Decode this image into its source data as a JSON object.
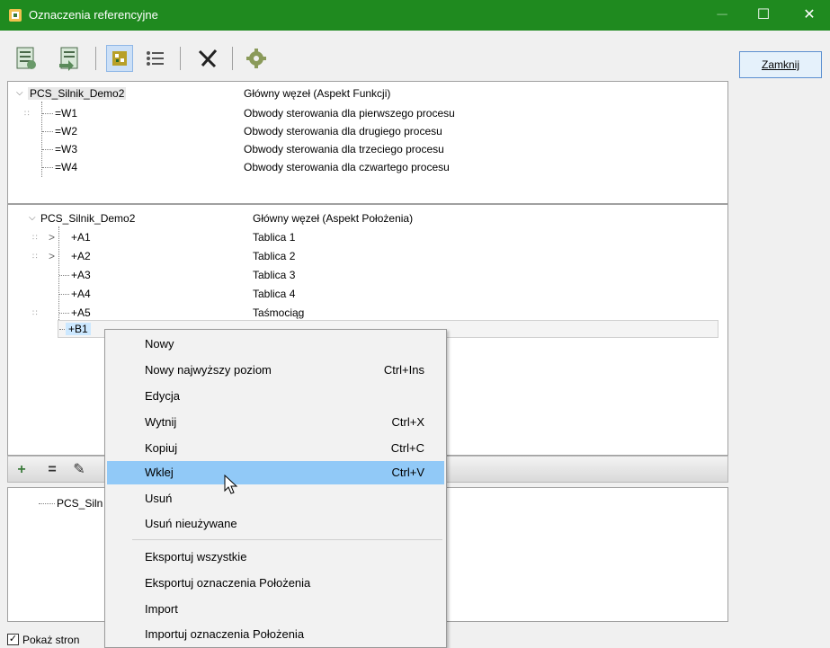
{
  "window": {
    "title": "Oznaczenia referencyjne",
    "minimize": "─",
    "maximize": "☐",
    "close": "✕"
  },
  "toolbar": {
    "icons": [
      "document-icon",
      "document-arrow-icon",
      "tree-view-icon",
      "list-view-icon",
      "cut-tool-icon",
      "gear-icon"
    ]
  },
  "close_button": {
    "label": "Zamknij"
  },
  "function_panel": {
    "rows": [
      {
        "name": "PCS_Silnik_Demo2",
        "desc": "Główny węzeł  (Aspekt Funkcji)"
      },
      {
        "name": "=W1",
        "desc": "Obwody sterowania dla pierwszego procesu"
      },
      {
        "name": "=W2",
        "desc": "Obwody sterowania dla drugiego procesu"
      },
      {
        "name": "=W3",
        "desc": "Obwody sterowania dla trzeciego procesu"
      },
      {
        "name": "=W4",
        "desc": "Obwody sterowania dla czwartego procesu"
      }
    ]
  },
  "location_panel": {
    "rows": [
      {
        "name": "PCS_Silnik_Demo2",
        "desc": "Główny węzeł  (Aspekt Położenia)"
      },
      {
        "name": "+A1",
        "desc": "Tablica 1"
      },
      {
        "name": "+A2",
        "desc": "Tablica 2"
      },
      {
        "name": "+A3",
        "desc": "Tablica 3"
      },
      {
        "name": "+A4",
        "desc": "Tablica 4"
      },
      {
        "name": "+A5",
        "desc": "Taśmociąg"
      },
      {
        "name": "+B1",
        "desc": ""
      }
    ]
  },
  "strip": {
    "add": "+",
    "remove": "=",
    "edit": "✎"
  },
  "bottom_panel": {
    "item": "PCS_Siln"
  },
  "checkbox": {
    "label": "Pokaż stron",
    "checked": true
  },
  "context_menu": {
    "items": [
      {
        "label": "Nowy",
        "shortcut": ""
      },
      {
        "label": "Nowy najwyższy poziom",
        "shortcut": "Ctrl+Ins"
      },
      {
        "label": "Edycja",
        "shortcut": ""
      },
      {
        "label": "Wytnij",
        "shortcut": "Ctrl+X"
      },
      {
        "label": "Kopiuj",
        "shortcut": "Ctrl+C"
      },
      {
        "label": "Wklej",
        "shortcut": "Ctrl+V"
      },
      {
        "label": "Usuń",
        "shortcut": ""
      },
      {
        "label": "Usuń nieużywane",
        "shortcut": ""
      },
      {
        "label": "Eksportuj wszystkie",
        "shortcut": ""
      },
      {
        "label": "Eksportuj oznaczenia Położenia",
        "shortcut": ""
      },
      {
        "label": "Import",
        "shortcut": ""
      },
      {
        "label": "Importuj oznaczenia Położenia",
        "shortcut": ""
      }
    ]
  },
  "colors": {
    "titlebar": "#1f8a1f",
    "highlight": "#91c9f7",
    "selection": "#cce8ff"
  }
}
